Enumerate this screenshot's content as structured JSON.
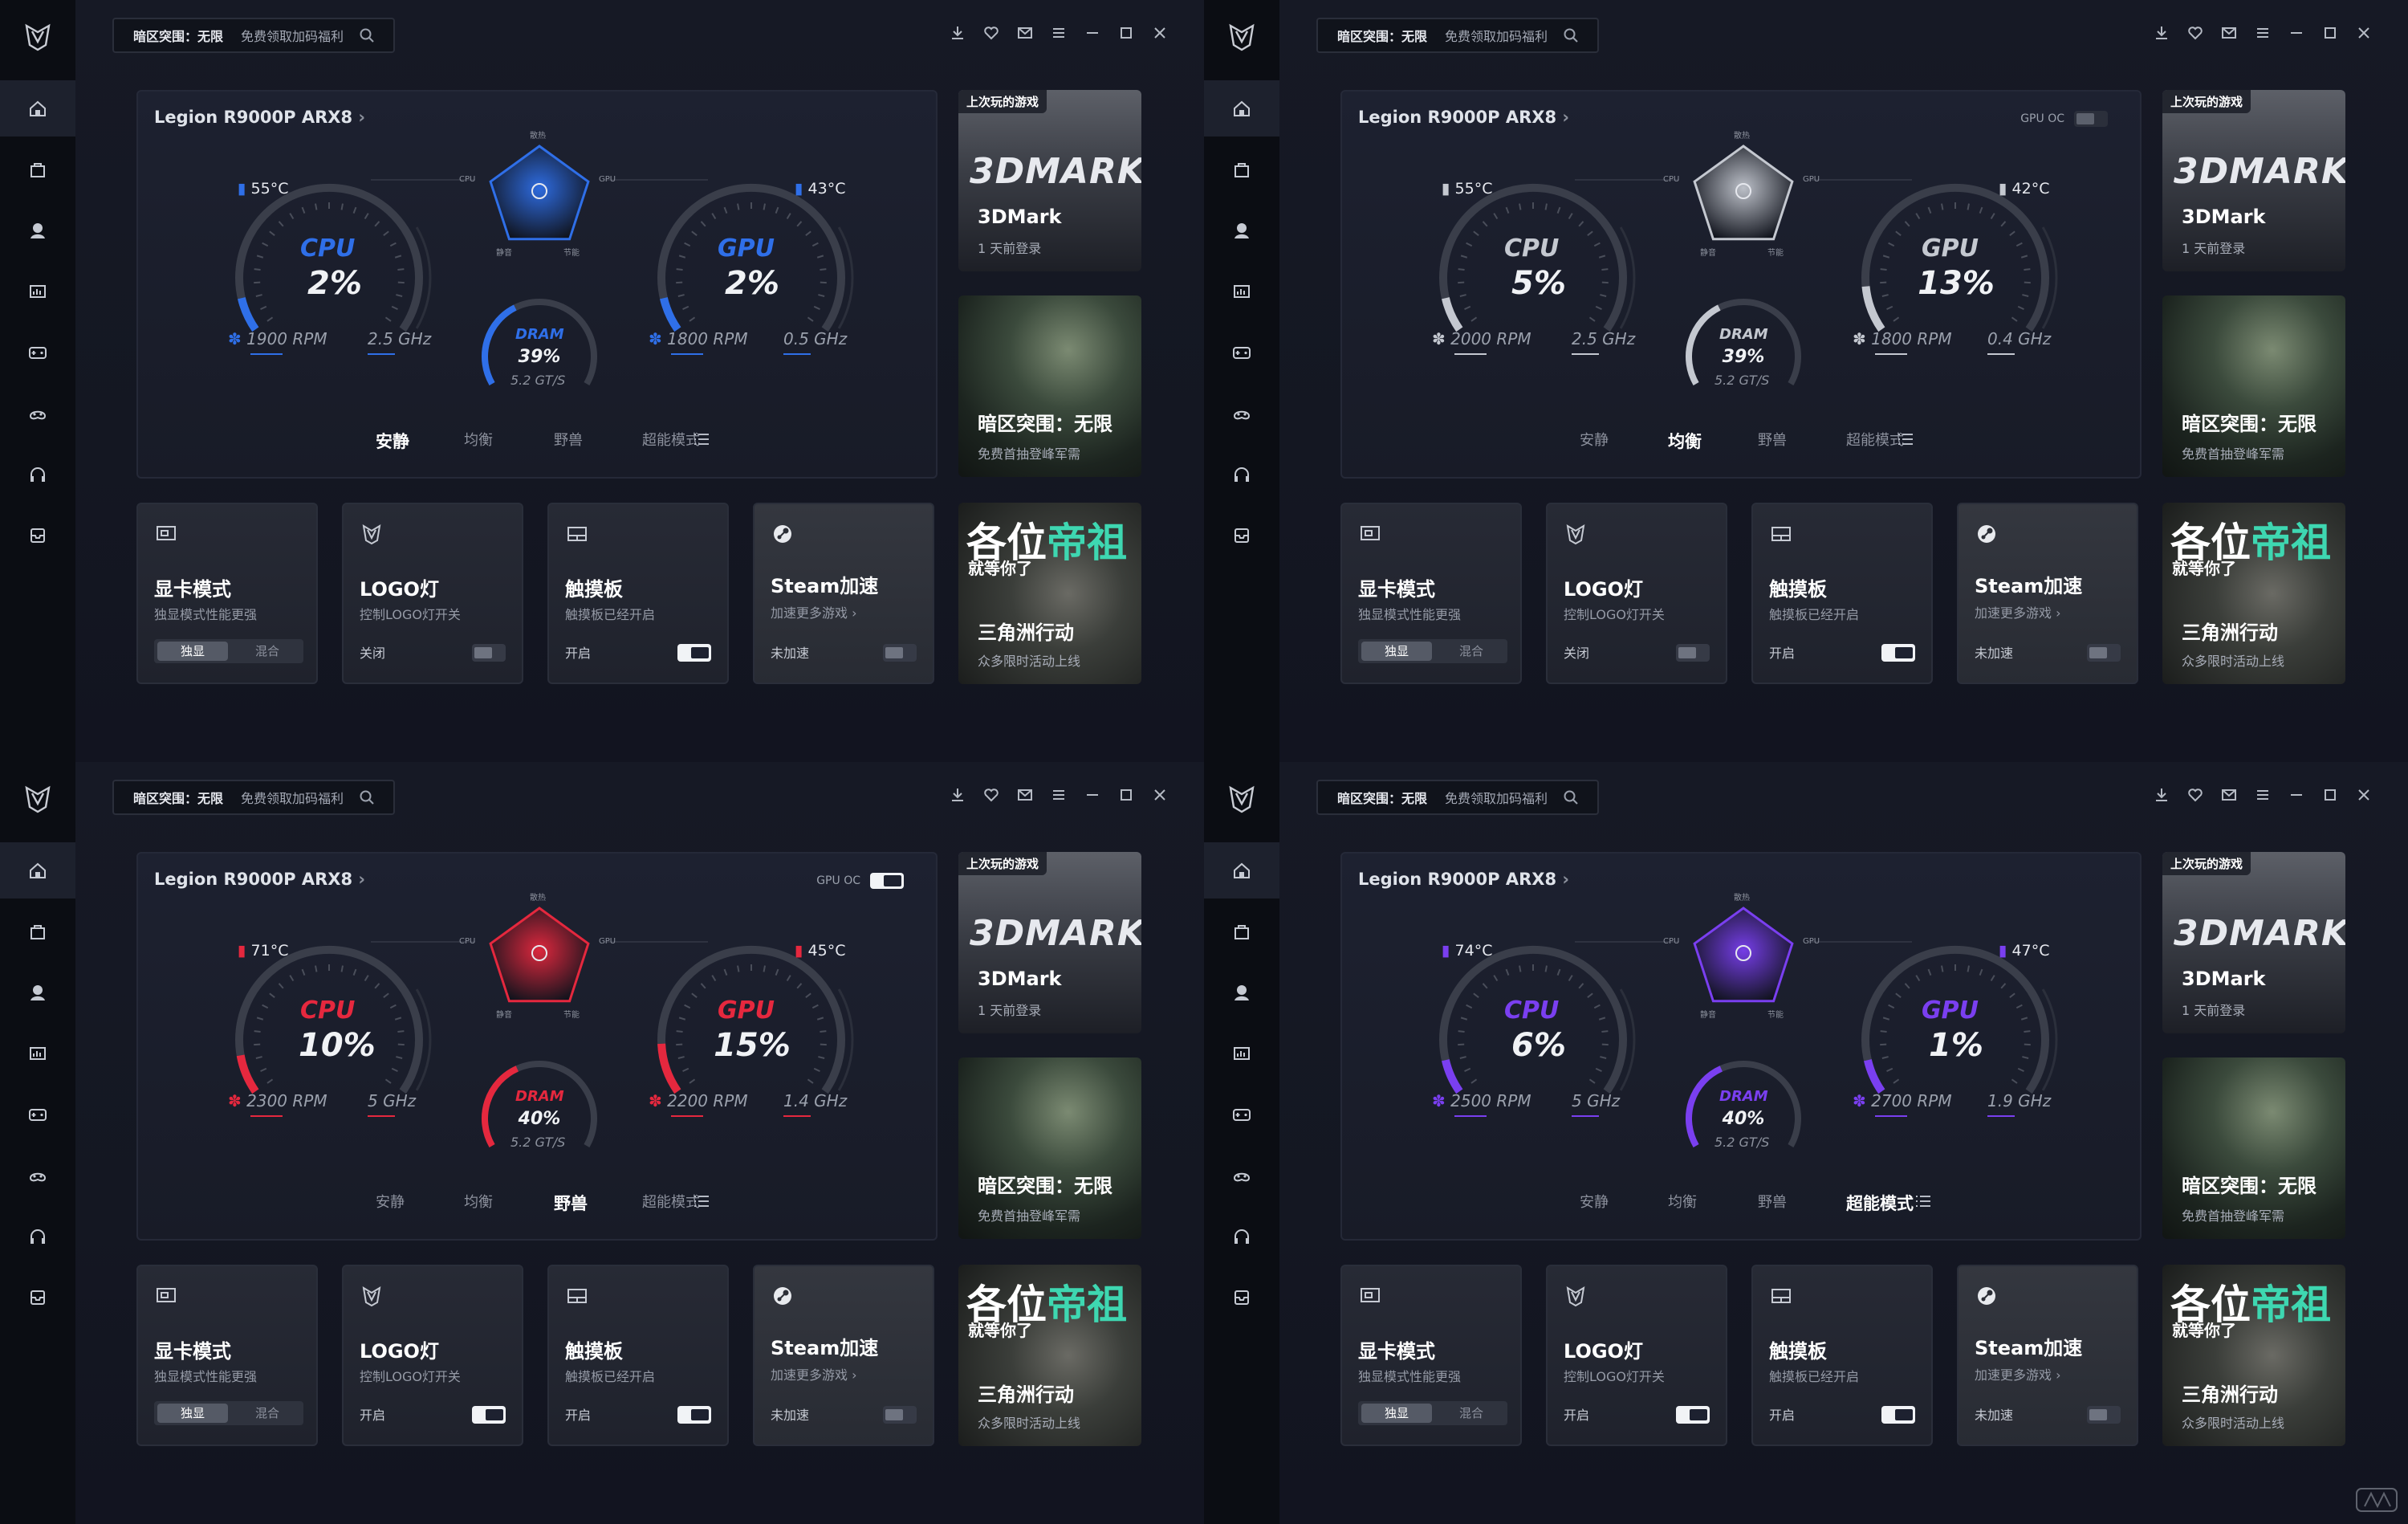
{
  "common": {
    "search": {
      "game": "暗区突围：无限",
      "promo": "免费领取加码福利"
    },
    "device_name": "Legion R9000P ARX8",
    "gpu_oc_label": "GPU OC",
    "mode_tabs": [
      "安静",
      "均衡",
      "野兽",
      "超能模式"
    ],
    "pentagon_labels": {
      "top": "散热",
      "left": "CPU",
      "right": "GPU",
      "bottom_left": "静音",
      "bottom_right": "节能"
    },
    "dram_label": "DRAM",
    "dram_speed": "5.2 GT/S",
    "cpu_label": "CPU",
    "gpu_label": "GPU",
    "games": [
      {
        "badge": "上次玩的游戏",
        "title": "3DMark",
        "subtitle": "1 天前登录",
        "logo": "3DMARK"
      },
      {
        "title": "暗区突围：无限",
        "subtitle": "免费首抽登峰军需"
      },
      {
        "poster_text": "各位",
        "poster_accent": "帝祖",
        "poster_sub": "就等你了",
        "title": "三角洲行动",
        "subtitle": "众多限时活动上线"
      }
    ],
    "controls": {
      "gpu_mode": {
        "title": "显卡模式",
        "subtitle": "独显模式性能更强",
        "options": [
          "独显",
          "混合"
        ]
      },
      "logo_light": {
        "title": "LOGO灯",
        "subtitle": "控制LOGO灯开关"
      },
      "touchpad": {
        "title": "触摸板",
        "subtitle": "触摸板已经开启",
        "state": "开启"
      },
      "steam": {
        "title": "Steam加速",
        "subtitle": "加速更多游戏 ›",
        "state": "未加速"
      }
    },
    "colors": {
      "quiet": "#2f6fe8",
      "balanced": "#9aa0ac",
      "beast": "#e5283e",
      "super": "#7a3ff0"
    }
  },
  "panels": [
    {
      "mode_index": 0,
      "accent": "#2f6fe8",
      "gpu_oc_visible": false,
      "gpu_oc_on": false,
      "cpu": {
        "temp": "55°C",
        "usage": "2%",
        "usage_fraction": 0.02,
        "rpm": "1900 RPM",
        "freq": "2.5 GHz"
      },
      "gpu": {
        "temp": "43°C",
        "usage": "2%",
        "usage_fraction": 0.02,
        "rpm": "1800 RPM",
        "freq": "0.5 GHz"
      },
      "dram": {
        "usage": "39%",
        "usage_fraction": 0.39
      },
      "logo_state": "关闭",
      "logo_on": false
    },
    {
      "mode_index": 1,
      "accent": "#c4c8d0",
      "gpu_oc_visible": true,
      "gpu_oc_on": false,
      "cpu": {
        "temp": "55°C",
        "usage": "5%",
        "usage_fraction": 0.05,
        "rpm": "2000 RPM",
        "freq": "2.5 GHz"
      },
      "gpu": {
        "temp": "42°C",
        "usage": "13%",
        "usage_fraction": 0.13,
        "rpm": "1800 RPM",
        "freq": "0.4 GHz"
      },
      "dram": {
        "usage": "39%",
        "usage_fraction": 0.39
      },
      "logo_state": "关闭",
      "logo_on": false
    },
    {
      "mode_index": 2,
      "accent": "#e5283e",
      "gpu_oc_visible": true,
      "gpu_oc_on": true,
      "cpu": {
        "temp": "71°C",
        "usage": "10%",
        "usage_fraction": 0.1,
        "rpm": "2300 RPM",
        "freq": "5 GHz"
      },
      "gpu": {
        "temp": "45°C",
        "usage": "15%",
        "usage_fraction": 0.15,
        "rpm": "2200 RPM",
        "freq": "1.4 GHz"
      },
      "dram": {
        "usage": "40%",
        "usage_fraction": 0.4
      },
      "logo_state": "开启",
      "logo_on": true
    },
    {
      "mode_index": 3,
      "accent": "#7a3ff0",
      "gpu_oc_visible": false,
      "gpu_oc_on": false,
      "cpu": {
        "temp": "74°C",
        "usage": "6%",
        "usage_fraction": 0.06,
        "rpm": "2500 RPM",
        "freq": "5 GHz"
      },
      "gpu": {
        "temp": "47°C",
        "usage": "1%",
        "usage_fraction": 0.01,
        "rpm": "2700 RPM",
        "freq": "1.9 GHz"
      },
      "dram": {
        "usage": "40%",
        "usage_fraction": 0.4
      },
      "logo_state": "开启",
      "logo_on": true
    }
  ],
  "icons": {
    "sidebar": [
      "home-icon",
      "bag-icon",
      "avatar-icon",
      "chart-icon",
      "gamepad-icon",
      "controller-icon",
      "headset-icon",
      "mailbox-icon"
    ],
    "window": [
      "download-icon",
      "heart-icon",
      "mail-icon",
      "menu-icon",
      "minimize-icon",
      "maximize-icon",
      "close-icon"
    ]
  }
}
